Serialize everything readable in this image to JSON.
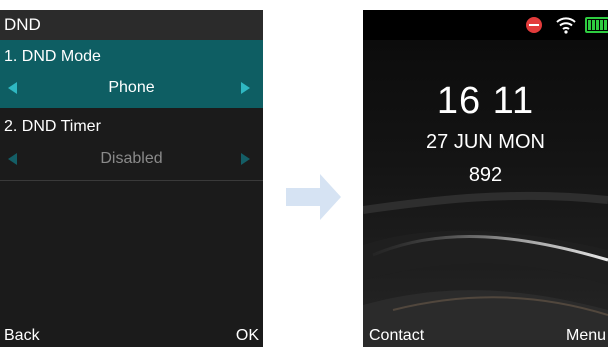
{
  "left_screen": {
    "title": "DND",
    "items": [
      {
        "label": "1. DND Mode",
        "value": "Phone"
      },
      {
        "label": "2. DND Timer",
        "value": "Disabled"
      }
    ],
    "softkeys": {
      "left": "Back",
      "right": "OK"
    }
  },
  "right_screen": {
    "status_icons": [
      "dnd-icon",
      "wifi-icon",
      "battery-icon"
    ],
    "time": "16 11",
    "date": "27 JUN MON",
    "extension": "892",
    "softkeys": {
      "left": "Contact",
      "right": "Menu"
    }
  },
  "colors": {
    "selected_row": "#0e5e63",
    "arrow_accent": "#2fb8c2",
    "flow_arrow": "#d6e3f3",
    "dnd_red": "#e23b3b",
    "battery_green": "#2ecc40"
  }
}
